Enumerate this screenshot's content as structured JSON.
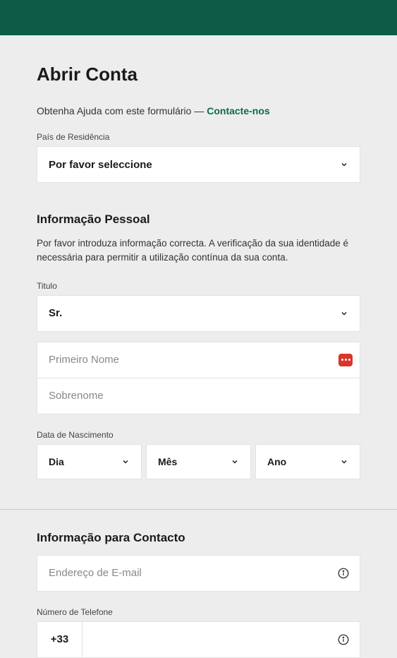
{
  "header": {},
  "page": {
    "title": "Abrir Conta",
    "help_text": "Obtenha Ajuda com este formulário — ",
    "help_link": "Contacte-nos"
  },
  "residence": {
    "label": "País de Residência",
    "value": "Por favor seleccione"
  },
  "personal": {
    "section_title": "Informação Pessoal",
    "section_desc": "Por favor introduza informação correcta. A verificação da sua identidade é necessária para permitir a utilização contínua da sua conta.",
    "title_label": "Titulo",
    "title_value": "Sr.",
    "first_name_placeholder": "Primeiro Nome",
    "last_name_placeholder": "Sobrenome",
    "dob_label": "Data de Nascimento",
    "day": "Dia",
    "month": "Mês",
    "year": "Ano"
  },
  "contact": {
    "section_title": "Informação para Contacto",
    "email_placeholder": "Endereço de E-mail",
    "phone_label": "Número de Telefone",
    "phone_prefix": "+33"
  }
}
